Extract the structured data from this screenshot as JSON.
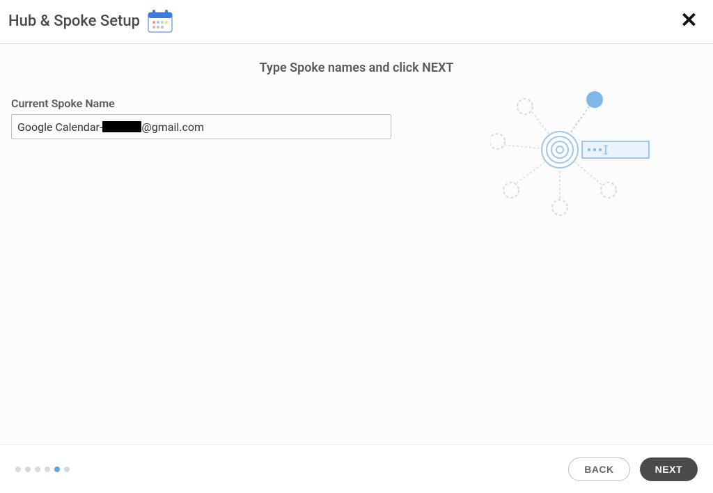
{
  "header": {
    "title": "Hub & Spoke Setup"
  },
  "instruction": "Type Spoke names and click NEXT",
  "form": {
    "label": "Current Spoke Name",
    "value_prefix": "Google Calendar-",
    "value_suffix": "@gmail.com"
  },
  "progress": {
    "total_steps": 6,
    "active_step": 5
  },
  "footer": {
    "back_label": "BACK",
    "next_label": "NEXT"
  },
  "colors": {
    "accent_blue": "#5aa9e6",
    "light_blue": "#b8d4ee",
    "button_dark": "#4a4a4a"
  }
}
